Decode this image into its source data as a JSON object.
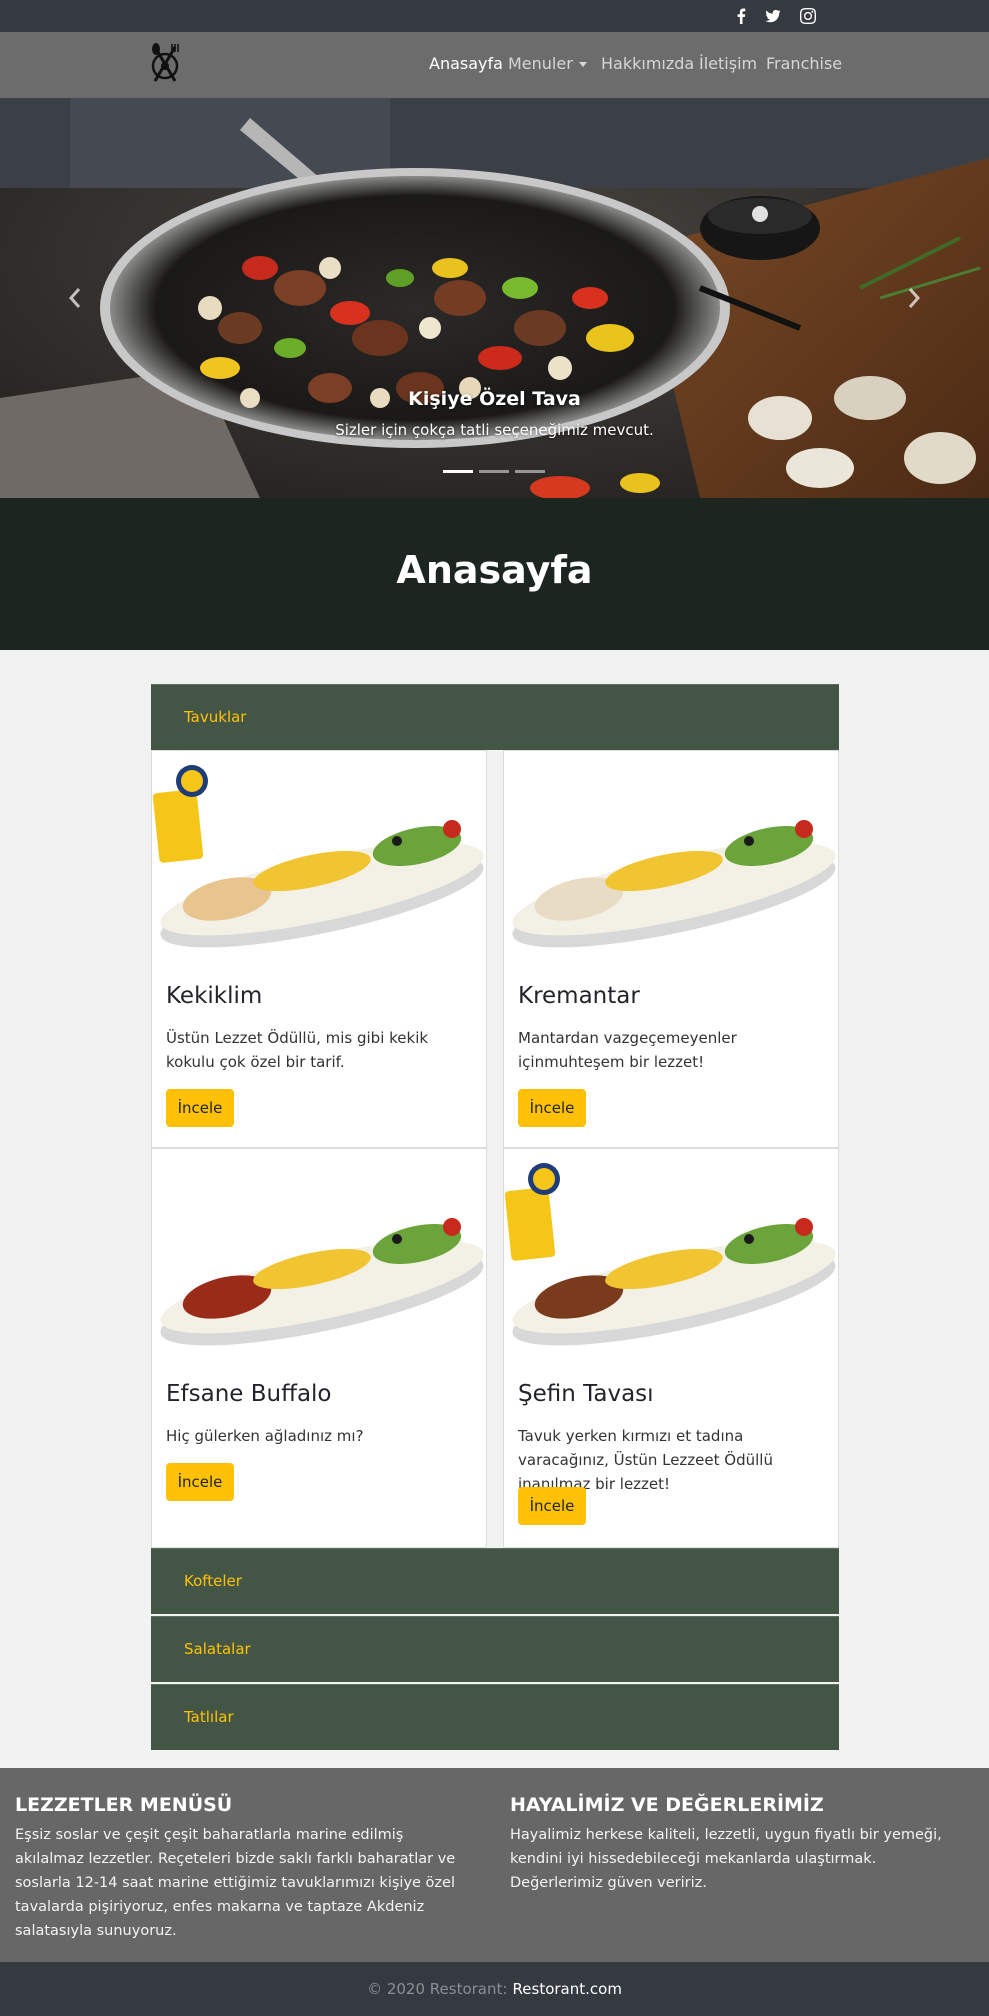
{
  "topbar": {
    "social_icons": [
      "facebook-icon",
      "twitter-icon",
      "instagram-icon"
    ]
  },
  "navbar": {
    "logo": "restaurant-logo-icon",
    "links": [
      {
        "label": "Anasayfa",
        "active": true
      },
      {
        "label": "Menuler",
        "dropdown": true
      },
      {
        "label": "Hakkımızda"
      },
      {
        "label": "İletişim"
      },
      {
        "label": "Franchise"
      }
    ]
  },
  "carousel": {
    "slide_title": "Kişiye Özel Tava",
    "slide_text": "Sizler için çokça tatli seçeneğimiz mevcut.",
    "indicator_count": 3,
    "active_indicator": 0
  },
  "page": {
    "title": "Anasayfa"
  },
  "menu": {
    "categories": [
      "Tavuklar",
      "Kofteler",
      "Salatalar",
      "Tatlılar"
    ],
    "open_category": "Tavuklar",
    "items": [
      {
        "name": "Kekiklim",
        "description": "Üstün Lezzet Ödüllü, mis gibi kekik kokulu çok özel bir tarif.",
        "button": "İncele",
        "award_badge": true
      },
      {
        "name": "Kremantar",
        "description": "Mantardan vazgeçemeyenler içinmuhteşem bir lezzet!",
        "button": "İncele",
        "award_badge": false
      },
      {
        "name": "Efsane Buffalo",
        "description": "Hiç gülerken ağladınız mı?",
        "button": "İncele",
        "award_badge": false
      },
      {
        "name": "Şefin Tavası",
        "description": "Tavuk yerken kırmızı et tadına varacağınız, Üstün Lezzeet Ödüllü inanılmaz bir lezzet!",
        "button": "İncele",
        "award_badge": true
      }
    ]
  },
  "footer": {
    "col1_title": "LEZZETLER MENÜSÜ",
    "col1_text": "Eşsiz soslar ve çeşit çeşit baharatlarla marine edilmiş akılalmaz lezzetler. Reçeteleri bizde saklı farklı baharatlar ve soslarla 12-14 saat marine ettiğimiz tavuklarımızı kişiye özel tavalarda pişiriyoruz, enfes makarna ve taptaze Akdeniz salatasıyla sunuyoruz.",
    "col2_title": "HAYALİMİZ VE DEĞERLERİMİZ",
    "col2_text": "Hayalimiz herkese kaliteli, lezzetli, uygun fiyatlı bir yemeği, kendini iyi hissedebileceği mekanlarda ulaştırmak. Değerlerimiz güven veririz.",
    "copyright": "© 2020 Restorant:",
    "site_link": "Restorant.com"
  },
  "colors": {
    "accent": "#ffc107",
    "accordion_bg": "#435545",
    "navbar_bg": "#6c6c6c",
    "dark_bar": "#343a40"
  }
}
